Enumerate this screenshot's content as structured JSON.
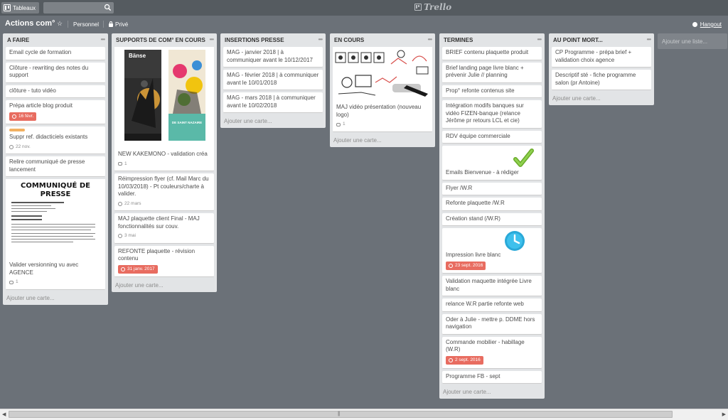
{
  "topbar": {
    "boards_label": "Tableaux",
    "logo_text": "Trello"
  },
  "board": {
    "title": "Actions com°",
    "team": "Personnel",
    "visibility": "Privé",
    "hangout": "Hangout"
  },
  "add_list_label": "Ajouter une liste...",
  "add_card_label": "Ajouter une carte...",
  "lists": [
    {
      "name": "A FAIRE",
      "cards": [
        {
          "title": "Email cycle de formation"
        },
        {
          "title": "Clôture - rewriting des notes du support"
        },
        {
          "title": "clôture - tuto vidéo"
        },
        {
          "title": "Prépa article blog produit",
          "due": "16 févr.",
          "due_status": "overdue"
        },
        {
          "title": "Suppr ref. didacticiels existants",
          "label_color": "#f2b061",
          "date": "22 nov."
        },
        {
          "title": "Relire communiqué de presse lancement"
        },
        {
          "title": "Valider versionning vu avec AGENCE",
          "cover": "press",
          "cover_title": "COMMUNIQUÉ DE PRESSE",
          "comments": "1"
        }
      ]
    },
    {
      "name": "SUPPORTS DE COM° EN COURS",
      "cards": [
        {
          "title": "NEW KAKEMONO - validation créa",
          "cover": "kakemono",
          "cover_text_left": "Bänse",
          "cover_text_right": "DE SAINT NAZAIRE",
          "comments": "1"
        },
        {
          "title": "Réimpression flyer (cf. Mail Marc du 10/03/2018) - Pt couleurs/charte à valider.",
          "date": "22 mars"
        },
        {
          "title": "MAJ plaquette client Final - MAJ fonctionnalités sur couv.",
          "date": "3 mai"
        },
        {
          "title": "REFONTE plaquette - révision contenu",
          "due": "31 janv. 2017",
          "due_status": "overdue"
        }
      ]
    },
    {
      "name": "INSERTIONS PRESSE",
      "cards": [
        {
          "title": "MAG - janvier 2018 | à communiquer avant le 10/12/2017"
        },
        {
          "title": "MAG - février 2018 | à communiquer avant le 10/01/2018"
        },
        {
          "title": "MAG - mars 2018 | à communiquer avant le 10/02/2018"
        }
      ]
    },
    {
      "name": "EN COURS",
      "cards": [
        {
          "title": "MAJ vidéo présentation (nouveau logo)",
          "cover": "video",
          "comments": "1"
        }
      ]
    },
    {
      "name": "TERMINES",
      "cards": [
        {
          "title": "BRIEF contenu plaquette produit"
        },
        {
          "title": "Brief landing page livre blanc + prévenir Julie // planning"
        },
        {
          "title": "Prop° refonte contenus site"
        },
        {
          "title": "Intégration modifs banques sur vidéo FIZEN-banque (relance Jérôme pr retours LCL et cie)"
        },
        {
          "title": "RDV équipe commerciale"
        },
        {
          "title": "Emails Bienvenue - à rédiger",
          "sticker": "check"
        },
        {
          "title": "Flyer /W.R"
        },
        {
          "title": "Refonte plaquette /W.R"
        },
        {
          "title": "Création stand (/W.R)"
        },
        {
          "title": "Impression livre blanc",
          "sticker": "clock",
          "due": "23 sept. 2016",
          "due_status": "overdue"
        },
        {
          "title": "Validation maquette intégrée Livre blanc"
        },
        {
          "title": "relance W.R partie refonte web"
        },
        {
          "title": "Oder à Julie - mettre p. DDME hors navigation"
        },
        {
          "title": "Commande mobilier - habillage (W.R)",
          "due": "2 sept. 2016",
          "due_status": "overdue"
        },
        {
          "title": "Programme FB - sept"
        }
      ]
    },
    {
      "name": "AU POINT MORT...",
      "cards": [
        {
          "title": "CP Programme - prépa brief + validation choix agence"
        },
        {
          "title": "Descriptif sté - fiche programme salon (pr Antoine)"
        }
      ]
    }
  ],
  "colors": {
    "board_bg": "#6b7178",
    "list_bg": "#e2e4e6",
    "due_overdue": "#e86c60",
    "label_orange": "#f2b061"
  }
}
